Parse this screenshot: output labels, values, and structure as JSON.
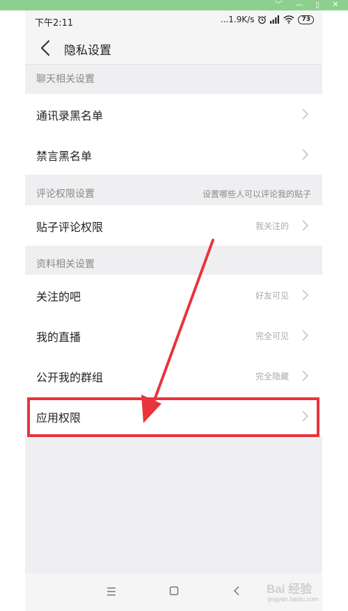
{
  "window": {
    "controls": [
      {
        "name": "dropdown-icon",
        "glyph": "﹀"
      },
      {
        "name": "minimize-icon",
        "glyph": "—"
      },
      {
        "name": "maximize-icon",
        "glyph": "▯"
      },
      {
        "name": "close-icon",
        "glyph": "✕"
      }
    ]
  },
  "status_bar": {
    "time": "下午2:11",
    "network_speed": "...1.9K/s",
    "icons": [
      "alarm-icon",
      "signal-icon",
      "wifi-icon"
    ],
    "battery": "73"
  },
  "header": {
    "back_icon": "chevron-left-icon",
    "title": "隐私设置"
  },
  "sections": {
    "chat": {
      "title": "聊天相关设置",
      "items": [
        {
          "label": "通讯录黑名单",
          "value": ""
        },
        {
          "label": "禁言黑名单",
          "value": ""
        }
      ]
    },
    "comment": {
      "title": "评论权限设置",
      "hint": "设置哪些人可以评论我的贴子",
      "items": [
        {
          "label": "贴子评论权限",
          "value": "我关注的"
        }
      ]
    },
    "profile": {
      "title": "资料相关设置",
      "items": [
        {
          "label": "关注的吧",
          "value": "好友可见"
        },
        {
          "label": "我的直播",
          "value": "完全可见"
        },
        {
          "label": "公开我的群组",
          "value": "完全隐藏"
        },
        {
          "label": "应用权限",
          "value": ""
        }
      ]
    }
  },
  "nav_bar": {
    "icons": [
      "menu-icon",
      "home-icon",
      "back-icon"
    ]
  },
  "annotation": {
    "highlight_color": "#e8343c",
    "highlighted_item": "应用权限"
  },
  "watermark": {
    "brand": "Bai 经验",
    "url": "jingyan.baidu.com"
  },
  "colors": {
    "window_bar": "#8ccf8e",
    "screen_bg": "#efeff1",
    "card_bg": "#ffffff",
    "secondary_text": "#888888"
  }
}
